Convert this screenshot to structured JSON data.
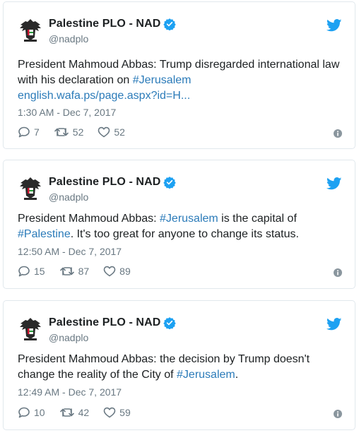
{
  "colors": {
    "link": "#2b7bb9",
    "muted": "#697882",
    "verified": "#1da1f2",
    "twitter": "#1da1f2"
  },
  "tweets": [
    {
      "name": "Palestine PLO - NAD",
      "handle": "@nadplo",
      "text_line1": "President Mahmoud Abbas: Trump disregarded international law",
      "text_line2_pre": "with his declaration on ",
      "text_line2_link": "#Jerusalem",
      "text_line3_link": "english.wafa.ps/page.aspx?id=H...",
      "time": "1:30 AM - Dec 7, 2017",
      "replies": "7",
      "retweets": "52",
      "likes": "52"
    },
    {
      "name": "Palestine PLO - NAD",
      "handle": "@nadplo",
      "text_line1_pre": "President Mahmoud Abbas: ",
      "text_line1_link": "#Jerusalem",
      "text_line1_post": " is the capital of",
      "text_line2_link": "#Palestine",
      "text_line2_post": ". It's too great for anyone to change its status.",
      "time": "12:50 AM - Dec 7, 2017",
      "replies": "15",
      "retweets": "87",
      "likes": "89"
    },
    {
      "name": "Palestine PLO - NAD",
      "handle": "@nadplo",
      "text_line1": "President Mahmoud Abbas: the decision by Trump doesn't",
      "text_line2_pre": "change the reality of the City of ",
      "text_line2_link": "#Jerusalem",
      "text_line2_post": ".",
      "time": "12:49 AM - Dec 7, 2017",
      "replies": "10",
      "retweets": "42",
      "likes": "59"
    }
  ]
}
